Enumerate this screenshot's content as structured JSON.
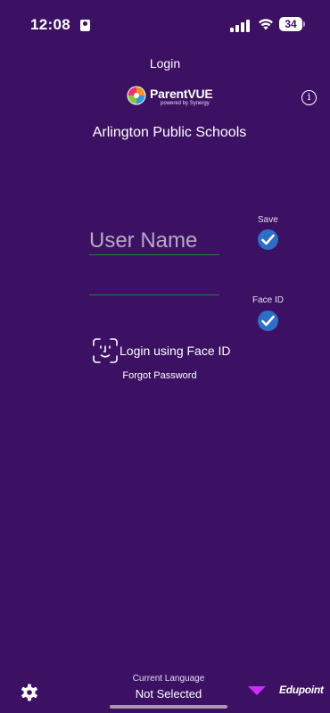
{
  "status_bar": {
    "time": "12:08",
    "battery": "34"
  },
  "header": {
    "title": "Login",
    "logo_name": "ParentVUE",
    "logo_sub": "powered by Synergy"
  },
  "district": "Arlington Public Schools",
  "form": {
    "username_placeholder": "User Name",
    "save_label": "Save",
    "save_checked": true,
    "faceid_label": "Face ID",
    "faceid_checked": true,
    "faceid_login": "Login using Face ID",
    "forgot_password": "Forgot Password"
  },
  "footer": {
    "language_label": "Current Language",
    "language_value": "Not Selected",
    "brand": "Edupoint"
  },
  "colors": {
    "background": "#3c1163",
    "check": "#2d6fc6",
    "underline": "#1f7f3e",
    "dropdown_arrow": "#d02bff"
  }
}
